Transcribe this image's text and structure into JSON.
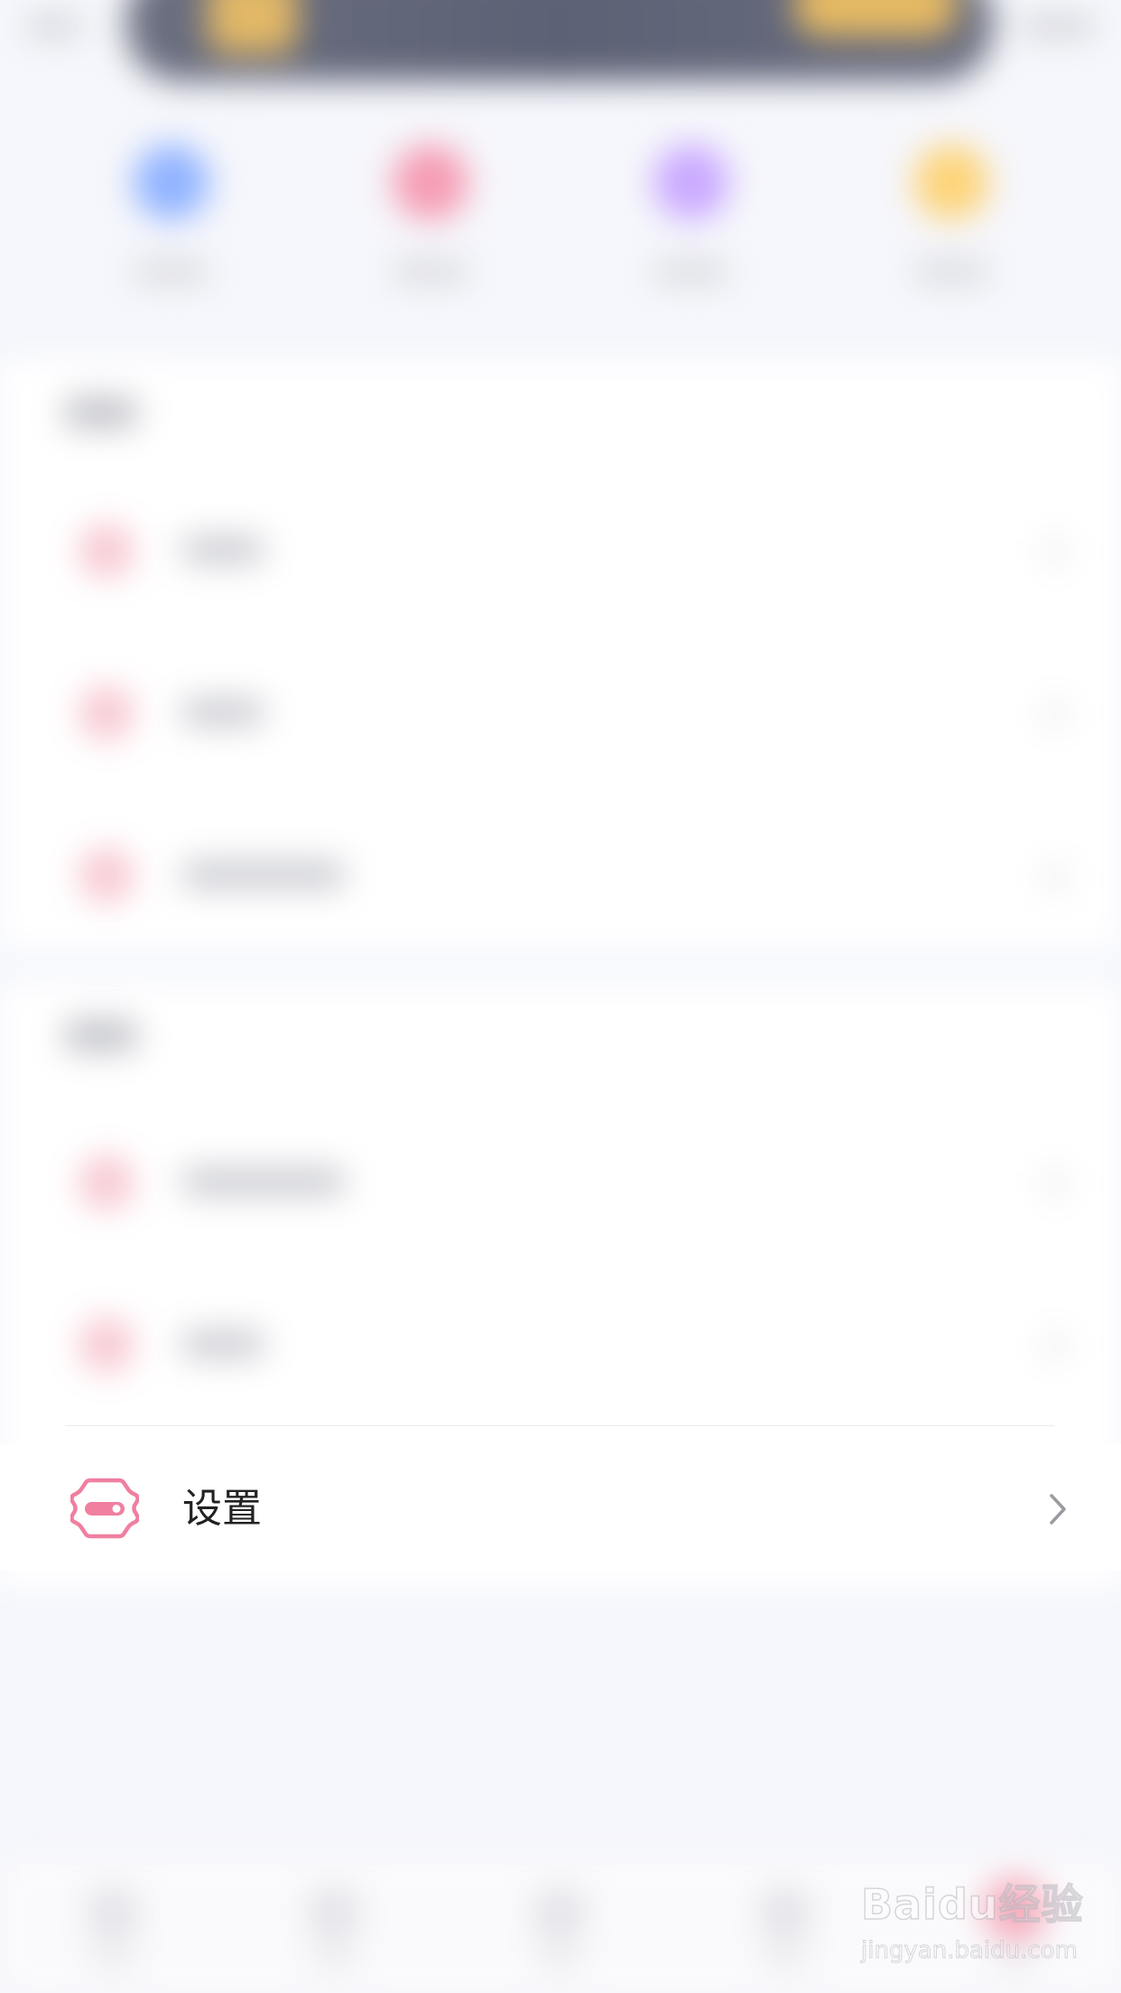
{
  "settings": {
    "label": "设置",
    "icon": "toggle-badge-icon",
    "accent_color": "#f07fa0"
  },
  "watermark": {
    "main": "Baidu经验",
    "sub": "jingyan.baidu.com"
  }
}
